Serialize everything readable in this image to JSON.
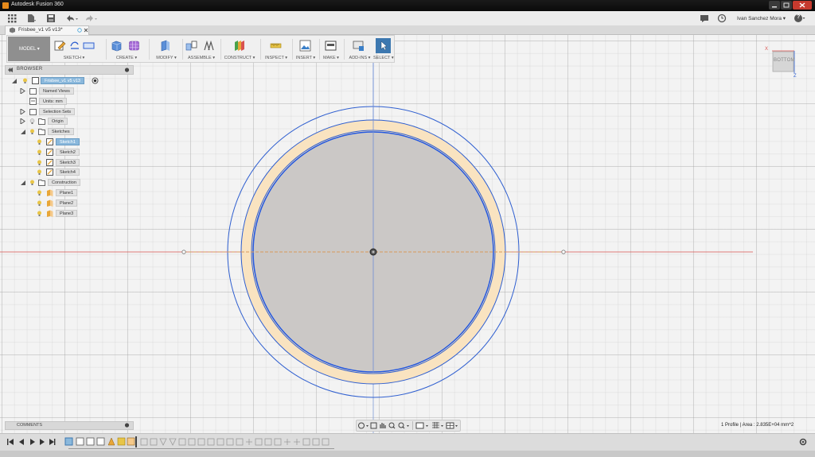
{
  "window": {
    "title": "Autodesk Fusion 360"
  },
  "app_bar": {
    "user_name": "Ivan Sanchez Mora ▾",
    "help_label": "?"
  },
  "document_tab": {
    "title": "Frisbee_v1 v5 v13*"
  },
  "toolbar": {
    "workspace": "MODEL ▾",
    "groups": [
      {
        "label": "SKETCH ▾",
        "icon": "sketch-icon"
      },
      {
        "label": "CREATE ▾",
        "icon": "create-icon"
      },
      {
        "label": "MODIFY ▾",
        "icon": "modify-icon"
      },
      {
        "label": "ASSEMBLE ▾",
        "icon": "assemble-icon"
      },
      {
        "label": "CONSTRUCT ▾",
        "icon": "construct-icon"
      },
      {
        "label": "INSPECT ▾",
        "icon": "inspect-icon"
      },
      {
        "label": "INSERT ▾",
        "icon": "insert-icon"
      },
      {
        "label": "MAKE ▾",
        "icon": "make-icon"
      },
      {
        "label": "ADD-INS ▾",
        "icon": "addins-icon"
      },
      {
        "label": "SELECT ▾",
        "icon": "select-icon"
      }
    ]
  },
  "browser": {
    "title": "BROWSER",
    "root": "Frisbee_v1 v5 v13",
    "nodes": [
      "Named Views",
      "Units: mm",
      "Selection Sets",
      "Origin",
      "Sketches",
      "Sketch1",
      "Sketch2",
      "Sketch3",
      "Sketch4",
      "Construction",
      "Plane1",
      "Plane2",
      "Plane3"
    ]
  },
  "comments": {
    "title": "COMMENTS"
  },
  "viewcube": {
    "face": "BOTTOM",
    "x_label": "X",
    "z_label": "Z"
  },
  "status": {
    "profile": "1 Profile | Area : 2.835E+04 mm^2"
  },
  "colors": {
    "sketch_blue": "#2f5fd0",
    "profile_fill": "#f9e3c0",
    "axis_red": "#d9534f",
    "selected_blue": "#8ab8dc"
  }
}
